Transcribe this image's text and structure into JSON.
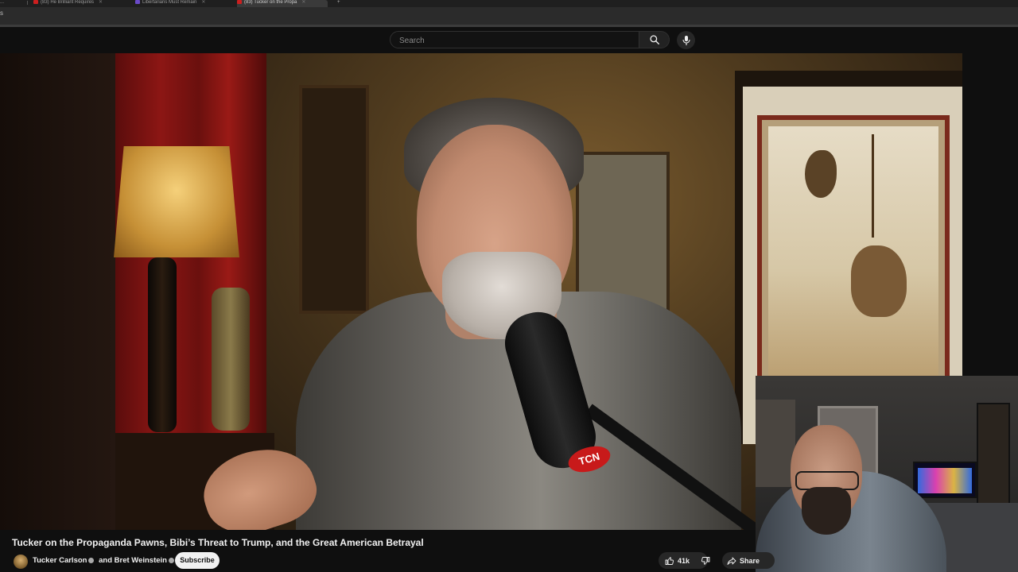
{
  "browser": {
    "tabs": [
      {
        "label": "...",
        "fav_color": "#5a5a5a"
      },
      {
        "label": "(83) He Brilliant Requires",
        "fav_color": "#cc1f1f"
      },
      {
        "label": "Libertarians Must Remain",
        "fav_color": "#6a4ac8"
      },
      {
        "label": "(83) Tucker on the Propa",
        "fav_color": "#cc1f1f"
      }
    ],
    "address_fragment": "s"
  },
  "search": {
    "placeholder": "Search",
    "search_icon": "search-icon",
    "mic_icon": "microphone-icon"
  },
  "video": {
    "mic_brand": "TCN"
  },
  "meta": {
    "title": "Tucker on the Propaganda Pawns, Bibi’s Threat to Trump, and the Great American Betrayal",
    "channel_1": "Tucker Carlson",
    "and_text": "and",
    "channel_2": "Bret Weinstein",
    "subscribe_label": "Subscribe",
    "likes": "41k",
    "share_label": "Share"
  },
  "icons": [
    "search-icon",
    "microphone-icon",
    "verified-icon",
    "like-icon",
    "dislike-icon",
    "share-icon"
  ],
  "colors": {
    "background": "#0f0f0f",
    "text": "#f1f1f1",
    "pill": "#272727",
    "subscribe_bg": "#f1f1f1"
  }
}
